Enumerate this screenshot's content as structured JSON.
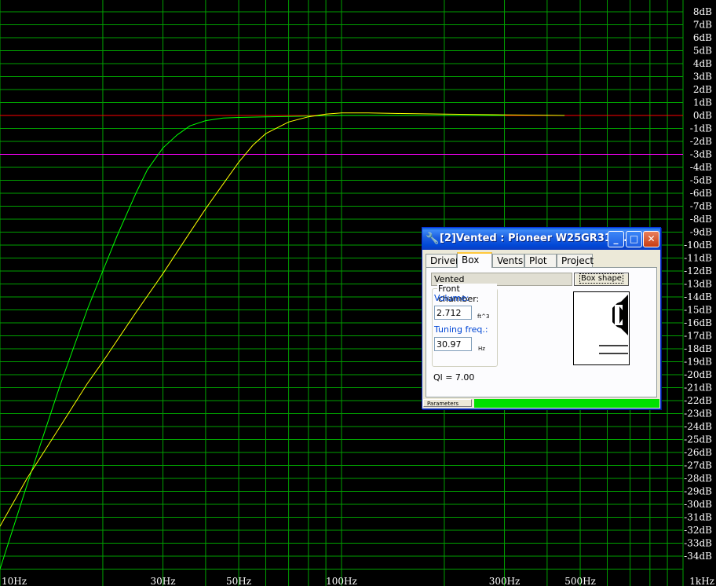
{
  "chart_data": {
    "type": "line",
    "xlim": [
      10,
      1000
    ],
    "xscale": "log",
    "ylim": [
      -35,
      9
    ],
    "ylabel_unit": "dB",
    "x_tick_labels": [
      {
        "value": 10,
        "label": "10Hz"
      },
      {
        "value": 30,
        "label": "30Hz"
      },
      {
        "value": 50,
        "label": "50Hz"
      },
      {
        "value": 100,
        "label": "100Hz"
      },
      {
        "value": 300,
        "label": "300Hz"
      },
      {
        "value": 500,
        "label": "500Hz"
      },
      {
        "value": 1000,
        "label": "1kHz"
      }
    ],
    "y_tick_labels": [
      {
        "value": 8,
        "label": "8dB"
      },
      {
        "value": 7,
        "label": "7dB"
      },
      {
        "value": 6,
        "label": "6dB"
      },
      {
        "value": 5,
        "label": "5dB"
      },
      {
        "value": 4,
        "label": "4dB"
      },
      {
        "value": 3,
        "label": "3dB"
      },
      {
        "value": 2,
        "label": "2dB"
      },
      {
        "value": 1,
        "label": "1dB"
      },
      {
        "value": 0,
        "label": "0dB"
      },
      {
        "value": -1,
        "label": "-1dB"
      },
      {
        "value": -2,
        "label": "-2dB"
      },
      {
        "value": -3,
        "label": "-3dB"
      },
      {
        "value": -4,
        "label": "-4dB"
      },
      {
        "value": -5,
        "label": "-5dB"
      },
      {
        "value": -6,
        "label": "-6dB"
      },
      {
        "value": -7,
        "label": "-7dB"
      },
      {
        "value": -8,
        "label": "-8dB"
      },
      {
        "value": -9,
        "label": "-9dB"
      },
      {
        "value": -10,
        "label": "-10dB"
      },
      {
        "value": -11,
        "label": "-11dB"
      },
      {
        "value": -12,
        "label": "-12dB"
      },
      {
        "value": -13,
        "label": "-13dB"
      },
      {
        "value": -14,
        "label": "-14dB"
      },
      {
        "value": -15,
        "label": "-15dB"
      },
      {
        "value": -16,
        "label": "-16dB"
      },
      {
        "value": -17,
        "label": "-17dB"
      },
      {
        "value": -18,
        "label": "-18dB"
      },
      {
        "value": -19,
        "label": "-19dB"
      },
      {
        "value": -20,
        "label": "-20dB"
      },
      {
        "value": -21,
        "label": "-21dB"
      },
      {
        "value": -22,
        "label": "-22dB"
      },
      {
        "value": -23,
        "label": "-23dB"
      },
      {
        "value": -24,
        "label": "-24dB"
      },
      {
        "value": -25,
        "label": "-25dB"
      },
      {
        "value": -26,
        "label": "-26dB"
      },
      {
        "value": -27,
        "label": "-27dB"
      },
      {
        "value": -28,
        "label": "-28dB"
      },
      {
        "value": -29,
        "label": "-29dB"
      },
      {
        "value": -30,
        "label": "-30dB"
      },
      {
        "value": -31,
        "label": "-31dB"
      },
      {
        "value": -32,
        "label": "-32dB"
      },
      {
        "value": -33,
        "label": "-33dB"
      },
      {
        "value": -34,
        "label": "-34dB"
      }
    ],
    "reference_lines": [
      {
        "y": 0,
        "color": "#ff0000"
      },
      {
        "y": -3,
        "color": "#ff00ff"
      }
    ],
    "grid": true,
    "grid_color": "#00a000",
    "series": [
      {
        "color": "#00ff00",
        "points": [
          [
            10,
            -35
          ],
          [
            12,
            -28.5
          ],
          [
            15,
            -20.8
          ],
          [
            18,
            -15
          ],
          [
            20,
            -12
          ],
          [
            22,
            -9.3
          ],
          [
            25,
            -6
          ],
          [
            27,
            -4.2
          ],
          [
            30,
            -2.5
          ],
          [
            33,
            -1.5
          ],
          [
            36,
            -0.8
          ],
          [
            40,
            -0.4
          ],
          [
            45,
            -0.2
          ],
          [
            50,
            -0.15
          ],
          [
            60,
            -0.1
          ],
          [
            80,
            -0.05
          ],
          [
            100,
            0
          ],
          [
            150,
            0
          ],
          [
            300,
            0
          ]
        ]
      },
      {
        "color": "#ffff00",
        "points": [
          [
            10,
            -31.7
          ],
          [
            12,
            -28
          ],
          [
            15,
            -24
          ],
          [
            18,
            -20.7
          ],
          [
            20,
            -19
          ],
          [
            25,
            -15.2
          ],
          [
            30,
            -12.2
          ],
          [
            35,
            -9.5
          ],
          [
            40,
            -7.2
          ],
          [
            45,
            -5.3
          ],
          [
            50,
            -3.6
          ],
          [
            55,
            -2.3
          ],
          [
            60,
            -1.4
          ],
          [
            70,
            -0.5
          ],
          [
            80,
            -0.1
          ],
          [
            90,
            0.1
          ],
          [
            100,
            0.2
          ],
          [
            120,
            0.2
          ],
          [
            150,
            0.15
          ],
          [
            200,
            0.1
          ],
          [
            300,
            0.05
          ],
          [
            400,
            0.02
          ],
          [
            450,
            0
          ]
        ]
      }
    ]
  },
  "dialog": {
    "title": "[2]Vented : Pioneer W25GR31-...",
    "title_icon": "wrench-icon",
    "buttons": {
      "minimize": "_",
      "maximize": "□",
      "close": "✕"
    },
    "tabs": [
      "Driver",
      "Box",
      "Vents",
      "Plot",
      "Project"
    ],
    "active_tab": "Box",
    "box_type": "Vented",
    "box_shape_button": "Box shape",
    "front_chamber_label": "Front chamber:",
    "volume_label": "Volume:",
    "volume_value": "2.712",
    "volume_unit": "ft^3",
    "tuning_label": "Tuning freq.:",
    "tuning_value": "30.97",
    "tuning_unit": "Hz",
    "ql": "Ql = 7.00",
    "status_label": "Parameters"
  },
  "colors": {
    "accent": "#0054e3",
    "status_fill": "#00e000"
  }
}
